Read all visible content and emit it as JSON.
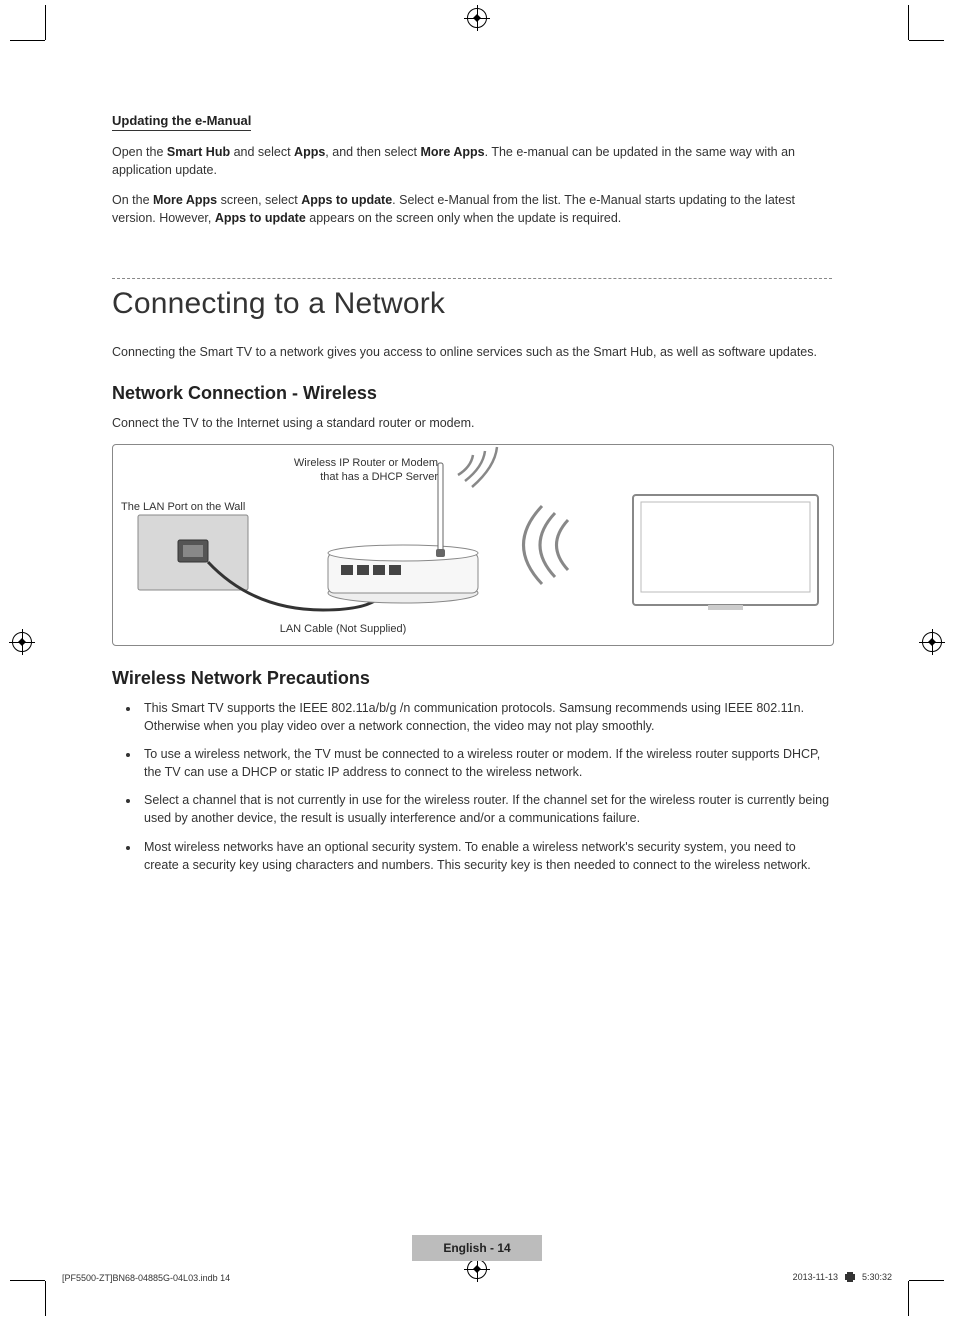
{
  "headings": {
    "updating": "Updating the e-Manual",
    "main": "Connecting to a Network",
    "wireless": "Network Connection - Wireless",
    "precautions": "Wireless Network Precautions"
  },
  "updating_paras": {
    "p1_a": "Open the ",
    "p1_b": "Smart Hub",
    "p1_c": " and select ",
    "p1_d": "Apps",
    "p1_e": ", and then select ",
    "p1_f": "More Apps",
    "p1_g": ". The e-manual can be updated in the same way with an application update.",
    "p2_a": "On the ",
    "p2_b": "More Apps",
    "p2_c": " screen, select ",
    "p2_d": "Apps to update",
    "p2_e": ". Select e-Manual from the list. The e-Manual starts updating to the latest version. However, ",
    "p2_f": "Apps to update",
    "p2_g": " appears on the screen only when the update is required."
  },
  "connecting_intro": "Connecting the Smart TV to a network gives you access to online services such as the Smart Hub, as well as software updates.",
  "wireless_intro": "Connect the TV to the Internet using a standard router or modem.",
  "diagram_labels": {
    "router": "Wireless IP Router or Modem\nthat has a DHCP Server",
    "lan_port": "The LAN Port on the Wall",
    "lan_cable": "LAN Cable (Not Supplied)"
  },
  "precautions": [
    "This Smart TV supports the IEEE 802.11a/b/g /n communication protocols. Samsung recommends using IEEE 802.11n. Otherwise when you play video over a network connection, the video may not play smoothly.",
    "To use a wireless network, the TV must be connected to a wireless router or modem. If the wireless router supports DHCP, the TV can use a DHCP or static IP address to connect to the wireless network.",
    "Select a channel that is not currently in use for the wireless router. If the channel set for the wireless router is currently being used by another device, the result is usually interference and/or a communications failure.",
    "Most wireless networks have an optional security system. To enable a wireless network's security system, you need to create a security key using characters and numbers. This security key is then needed to connect to the wireless network."
  ],
  "footer": {
    "page_label": "English - 14",
    "doc_left": "[PF5500-ZT]BN68-04885G-04L03.indb   14",
    "doc_right_date": "2013-11-13",
    "doc_right_time": "5:30:32"
  }
}
